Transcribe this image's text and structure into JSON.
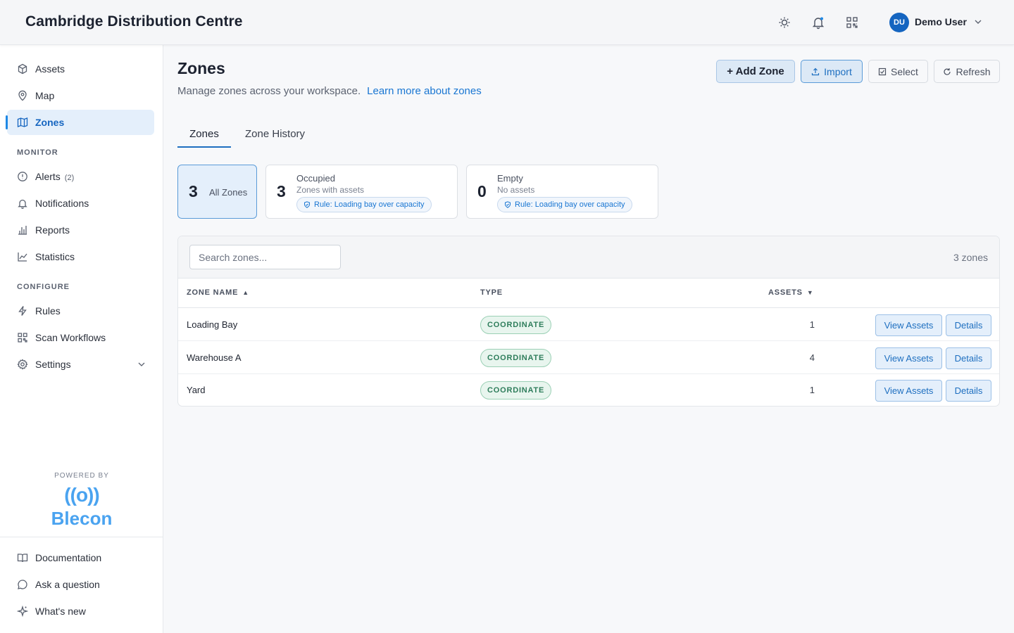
{
  "header": {
    "title": "Cambridge Distribution Centre",
    "user_initials": "DU",
    "user_name": "Demo User"
  },
  "sidebar": {
    "items": [
      {
        "label": "Assets",
        "icon": "cube-icon"
      },
      {
        "label": "Map",
        "icon": "map-pin-icon"
      },
      {
        "label": "Zones",
        "icon": "map-icon",
        "active": true
      }
    ],
    "monitor_label": "MONITOR",
    "monitor_items": [
      {
        "label": "Alerts",
        "count": "(2)",
        "icon": "alert-circle-icon"
      },
      {
        "label": "Notifications",
        "icon": "bell-icon"
      },
      {
        "label": "Reports",
        "icon": "bar-chart-icon"
      },
      {
        "label": "Statistics",
        "icon": "line-chart-icon"
      }
    ],
    "configure_label": "CONFIGURE",
    "configure_items": [
      {
        "label": "Rules",
        "icon": "lightning-icon"
      },
      {
        "label": "Scan Workflows",
        "icon": "grid-icon"
      },
      {
        "label": "Settings",
        "icon": "gear-icon"
      }
    ],
    "powered_by": "POWERED BY",
    "brand_wave": "((o))",
    "brand_name": "Blecon",
    "footer_items": [
      {
        "label": "Documentation",
        "icon": "book-icon"
      },
      {
        "label": "Ask a question",
        "icon": "chat-icon"
      },
      {
        "label": "What's new",
        "icon": "sparkle-icon"
      }
    ]
  },
  "main": {
    "title": "Zones",
    "subtitle": "Manage zones across your workspace.",
    "learn_more": "Learn more about zones",
    "buttons": {
      "add": "+ Add Zone",
      "import": "Import",
      "select": "Select",
      "refresh": "Refresh"
    },
    "tabs": [
      {
        "label": "Zones",
        "active": true
      },
      {
        "label": "Zone History"
      }
    ],
    "cards": {
      "all": {
        "count": "3",
        "label": "All Zones"
      },
      "occupied": {
        "count": "3",
        "title": "Occupied",
        "desc": "Zones with assets",
        "rule": "Rule: Loading bay over capacity"
      },
      "empty": {
        "count": "0",
        "title": "Empty",
        "desc": "No assets",
        "rule": "Rule: Loading bay over capacity"
      }
    },
    "table": {
      "search_placeholder": "Search zones...",
      "count": "3 zones",
      "columns": {
        "name": "ZONE NAME",
        "type": "TYPE",
        "assets": "ASSETS"
      },
      "sort_name_arrow": "▲",
      "sort_assets_arrow": "▼",
      "view_label": "View Assets",
      "details_label": "Details",
      "rows": [
        {
          "name": "Loading Bay",
          "type": "COORDINATE",
          "assets": "1"
        },
        {
          "name": "Warehouse A",
          "type": "COORDINATE",
          "assets": "4"
        },
        {
          "name": "Yard",
          "type": "COORDINATE",
          "assets": "1"
        }
      ]
    }
  },
  "colors": {
    "accent": "#1565c0",
    "accent_light": "#e4effb",
    "brand": "#4aa3f0",
    "badge_green": "#2e7d5b"
  }
}
